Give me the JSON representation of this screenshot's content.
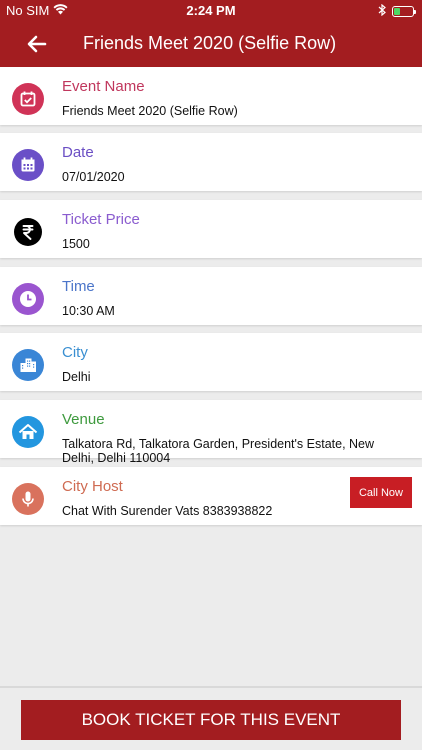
{
  "status_bar": {
    "carrier": "No SIM",
    "time": "2:24 PM"
  },
  "header": {
    "title": "Friends Meet 2020 (Selfie Row)"
  },
  "details": [
    {
      "label": "Event Name",
      "value": "Friends Meet 2020 (Selfie Row)",
      "icon": "calendar-check-icon",
      "icon_color": "#d03357",
      "label_color": "#c0375d"
    },
    {
      "label": "Date",
      "value": "07/01/2020",
      "icon": "calendar-icon",
      "icon_color": "#6a4fc7",
      "label_color": "#6b4fc4"
    },
    {
      "label": "Ticket Price",
      "value": "1500",
      "icon": "rupee-icon",
      "icon_color": "#000000",
      "label_color": "#8a5ccf"
    },
    {
      "label": "Time",
      "value": "10:30 AM",
      "icon": "clock-icon",
      "icon_color": "#9a55cf",
      "label_color": "#4b75c9"
    },
    {
      "label": "City",
      "value": "Delhi",
      "icon": "city-icon",
      "icon_color": "#3a86d6",
      "label_color": "#3a8fd1"
    },
    {
      "label": "Venue",
      "value": "Talkatora Rd, Talkatora Garden, President's Estate, New Delhi, Delhi 110004",
      "icon": "home-icon",
      "icon_color": "#2396df",
      "label_color": "#3e9a3e"
    },
    {
      "label": "City Host",
      "value": "Chat With Surender Vats 8383938822",
      "icon": "microphone-icon",
      "icon_color": "#d9725d",
      "label_color": "#cf6b52"
    }
  ],
  "call_now_label": "Call Now",
  "book_button_label": "BOOK TICKET FOR THIS EVENT"
}
